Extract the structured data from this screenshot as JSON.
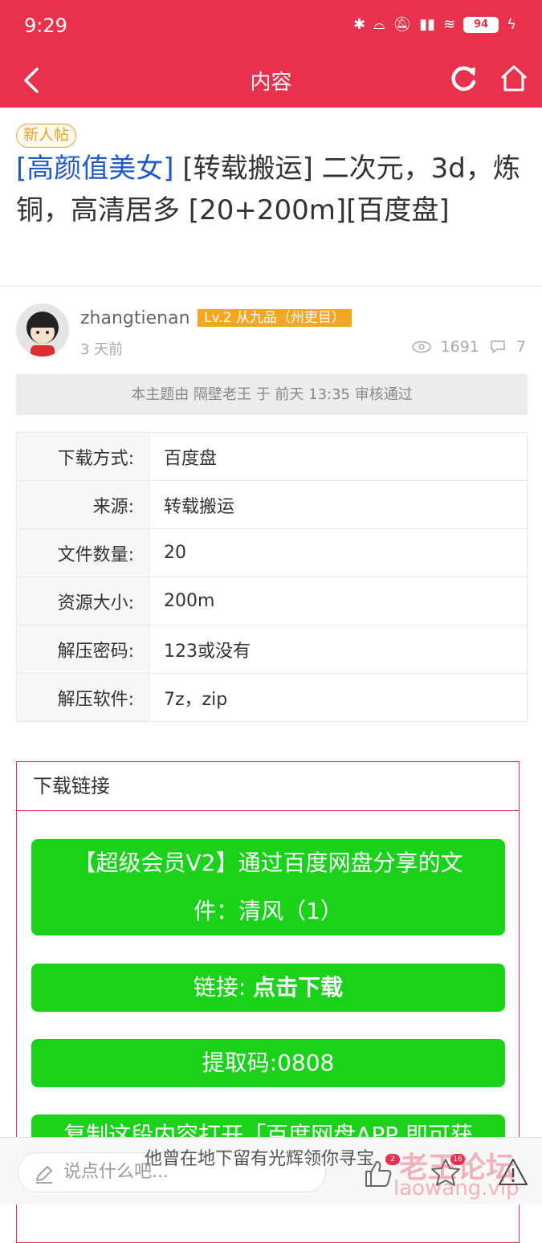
{
  "status_bar": {
    "time": "9:29",
    "battery": "94"
  },
  "nav": {
    "title": "内容"
  },
  "post": {
    "tag": "新人帖",
    "category": "[高颜值美女]",
    "title_rest": " [转载搬运] 二次元，3d，炼铜，高清居多 [20+200m][百度盘]"
  },
  "author": {
    "name": "zhangtienan",
    "level": "Lv.2 从九品（州吏目）",
    "time": "3 天前",
    "views": "1691",
    "replies": "7"
  },
  "audit_text": "本主题由 隔壁老王 于 前天 13:35 审核通过",
  "info_rows": [
    {
      "key": "下载方式:",
      "value": "百度盘"
    },
    {
      "key": "来源:",
      "value": "转载搬运"
    },
    {
      "key": "文件数量:",
      "value": "20"
    },
    {
      "key": "资源大小:",
      "value": "200m"
    },
    {
      "key": "解压密码:",
      "value": "123或没有"
    },
    {
      "key": "解压软件:",
      "value": "7z，zip"
    }
  ],
  "download": {
    "header": "下载链接",
    "share_line1": "【超级会员V2】通过百度网盘分享的文",
    "share_line2": "件：清风（1）",
    "link_label": "链接:",
    "link_action": "点击下载",
    "code": "提取码:0808",
    "copy_text": "复制这段内容打开「百度网盘APP 即可获"
  },
  "bottom": {
    "comment_placeholder": "说点什么吧...",
    "slogan": "他曾在地下留有光辉领你寻宝",
    "like_badge": "2",
    "fav_badge": "16",
    "watermark_cn": "老王论坛",
    "watermark_url": "laowang.vip"
  },
  "colors": {
    "brand": "#e8314d",
    "green_button": "#1bd21b",
    "category_link": "#1e5bc6",
    "level_badge": "#f5a623"
  }
}
